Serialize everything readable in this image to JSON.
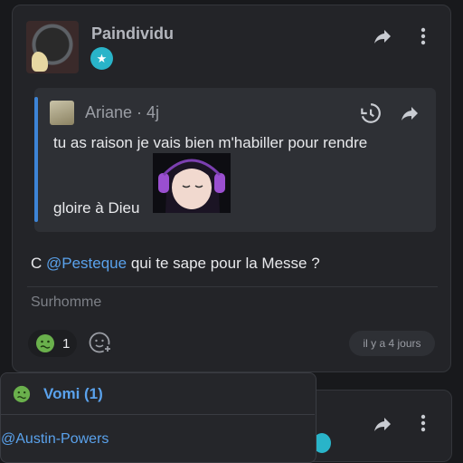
{
  "post": {
    "author": "Paindividu",
    "quote": {
      "author": "Ariane",
      "age": "· 4j",
      "text_line1": "tu as raison je vais bien m'habiller pour rendre",
      "text_line2": "gloire à Dieu"
    },
    "body_prefix": "C ",
    "body_mention": "@Pesteque",
    "body_suffix": " qui te sape pour la Messe ?",
    "signature": "Surhomme",
    "reaction_count": "1",
    "timestamp": "il y a 4 jours"
  },
  "reaction_popup": {
    "title": "Vomi (1)",
    "users": [
      "@Austin-Powers"
    ]
  },
  "colors": {
    "accent": "#5aa2ec",
    "quote_bar": "#3d84d6",
    "badge": "#29b4c9",
    "reaction": "#6ab04c"
  },
  "icons": [
    "share-icon",
    "more-vertical-icon",
    "history-icon",
    "nauseated-face-icon",
    "add-reaction-icon",
    "star-badge-icon"
  ]
}
